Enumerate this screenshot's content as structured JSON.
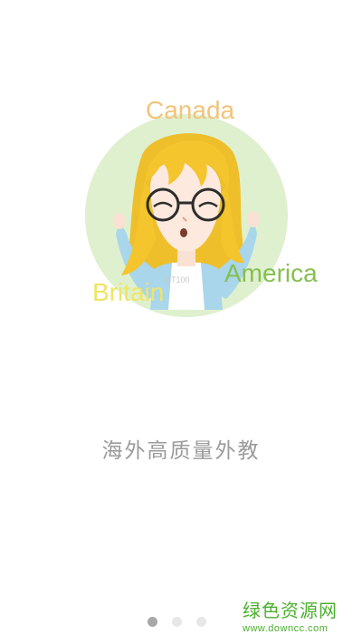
{
  "onboarding": {
    "countries": {
      "canada": "Canada",
      "america": "America",
      "britain": "Britain"
    },
    "avatar_watermark": "ET100",
    "tagline": "海外高质量外教",
    "pager": {
      "total": 3,
      "active_index": 0
    }
  },
  "watermark": {
    "name": "绿色资源网",
    "url": "www.downcc.com"
  },
  "colors": {
    "canada": "#f2c37a",
    "america": "#86bf4f",
    "britain": "#efe564",
    "circle": "#dff0cf",
    "brand": "#4caf2f"
  }
}
